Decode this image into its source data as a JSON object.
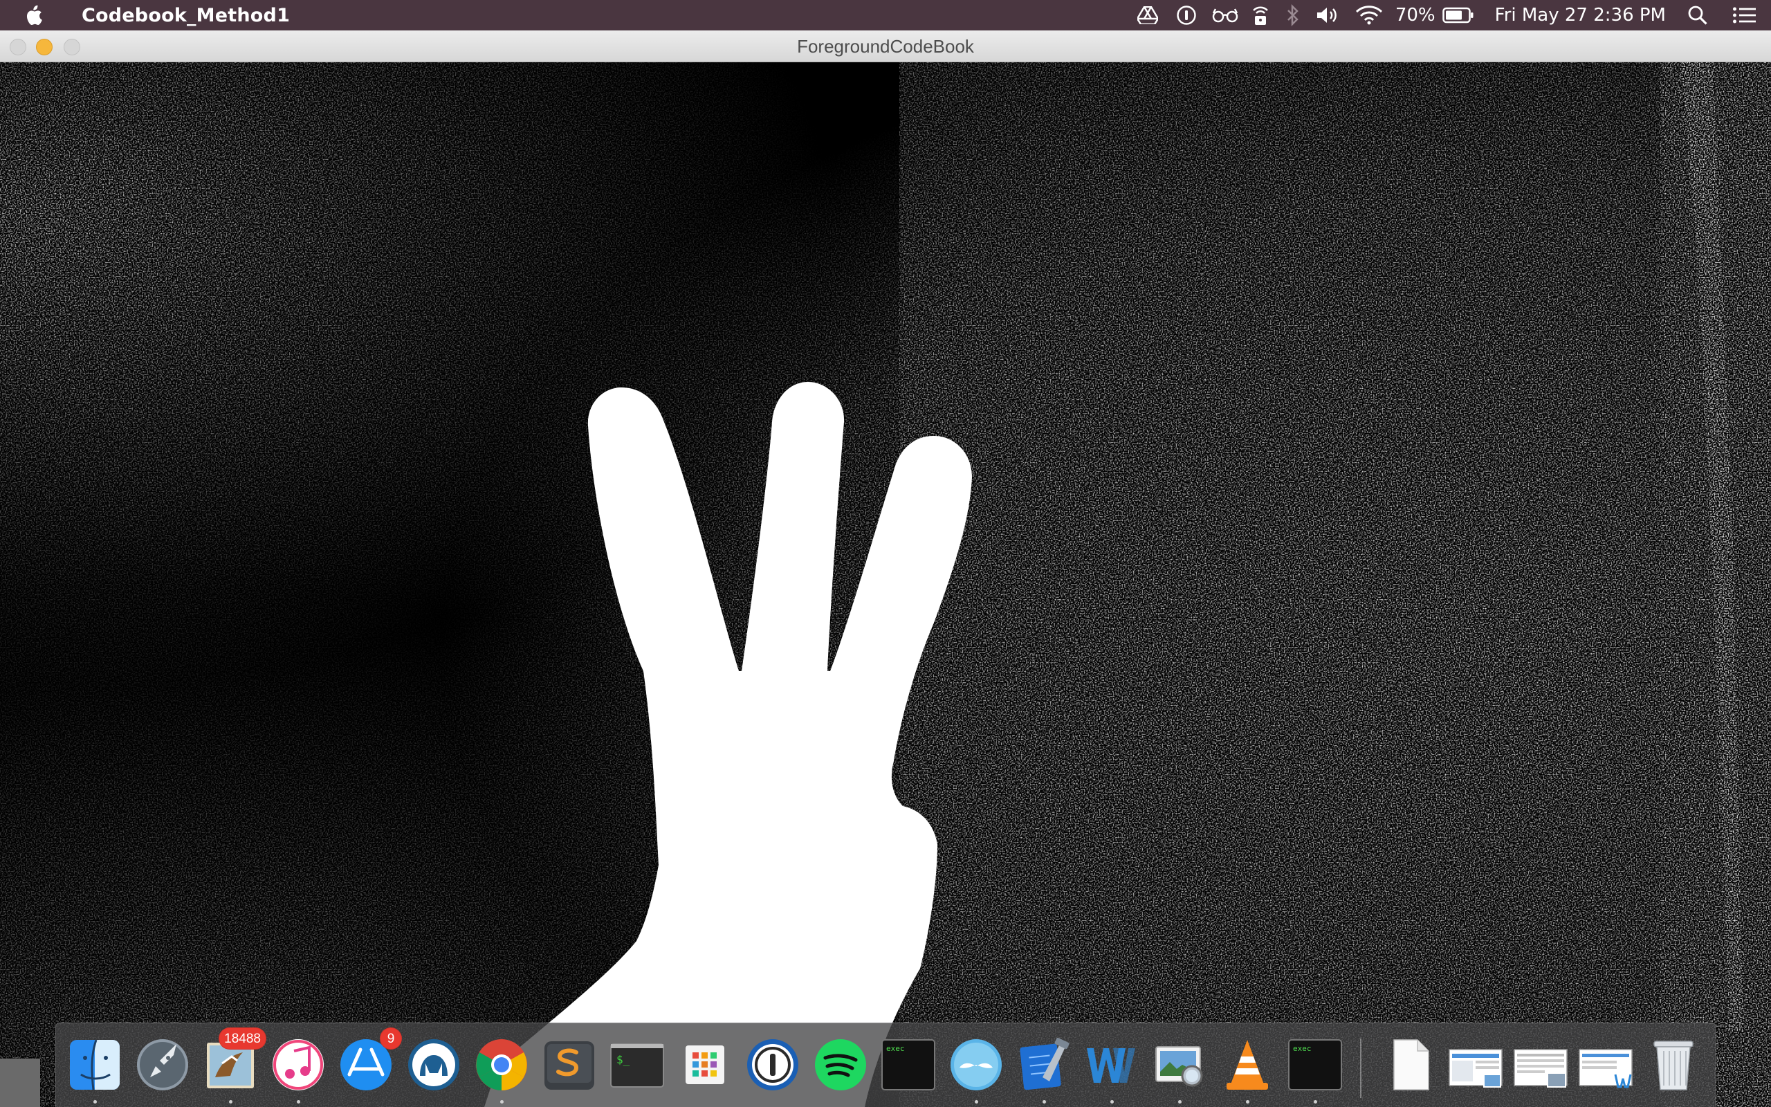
{
  "menubar": {
    "app_name": "Codebook_Method1",
    "battery_percent": "70%",
    "datetime": "Fri May 27  2:36 PM",
    "status_icons": [
      "google-drive-icon",
      "onepassword-icon",
      "reading-glasses-icon",
      "lock-wifi-icon",
      "bluetooth-icon",
      "volume-icon",
      "wifi-icon",
      "battery-icon",
      "spotlight-icon",
      "notification-center-icon"
    ]
  },
  "window": {
    "title": "ForegroundCodeBook"
  },
  "dock": {
    "apps": [
      {
        "name": "finder",
        "running": true
      },
      {
        "name": "launchpad",
        "running": false
      },
      {
        "name": "mail",
        "running": true,
        "badge": "18488"
      },
      {
        "name": "itunes",
        "running": true
      },
      {
        "name": "app-store",
        "running": false,
        "badge": "9"
      },
      {
        "name": "sequel-pro",
        "running": false
      },
      {
        "name": "chrome",
        "running": true
      },
      {
        "name": "sublime-text",
        "running": false
      },
      {
        "name": "terminal",
        "running": false
      },
      {
        "name": "apps-grid",
        "running": false
      },
      {
        "name": "1password",
        "running": false
      },
      {
        "name": "spotify",
        "running": false
      },
      {
        "name": "exec-1",
        "running": false,
        "label": "exec"
      },
      {
        "name": "unibox",
        "running": true
      },
      {
        "name": "xcode",
        "running": true
      },
      {
        "name": "word",
        "running": true
      },
      {
        "name": "preview",
        "running": true
      },
      {
        "name": "vlc",
        "running": true
      },
      {
        "name": "exec-2",
        "running": true,
        "label": "exec"
      }
    ],
    "stacks": [
      "document-stack",
      "screenshots-stack-1",
      "screenshots-stack-2",
      "word-doc-stack",
      "trash"
    ]
  },
  "colors": {
    "menubar_bg": "#4a3640",
    "badge_red": "#e8382f",
    "minimize_yellow": "#f6b73c"
  }
}
